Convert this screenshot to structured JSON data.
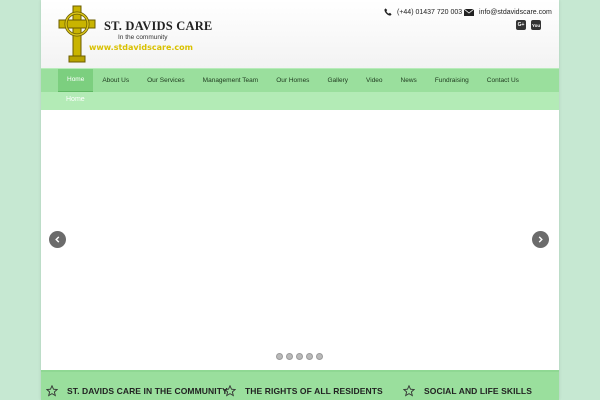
{
  "header": {
    "brand_name": "ST. DAVIDS CARE",
    "tagline": "In the community",
    "website": "www.stdavidscare.com",
    "phone": "(+44) 01437 720 003",
    "email": "info@stdavidscare.com",
    "social": [
      {
        "name": "google-plus",
        "label": "G+"
      },
      {
        "name": "youtube",
        "label": "You"
      }
    ]
  },
  "nav": {
    "items": [
      {
        "label": "Home",
        "active": true
      },
      {
        "label": "About Us"
      },
      {
        "label": "Our Services"
      },
      {
        "label": "Management Team"
      },
      {
        "label": "Our Homes"
      },
      {
        "label": "Gallery"
      },
      {
        "label": "Video"
      },
      {
        "label": "News"
      },
      {
        "label": "Fundraising"
      },
      {
        "label": "Contact Us"
      }
    ]
  },
  "breadcrumb": {
    "current": "Home"
  },
  "slider": {
    "slide_count": 5
  },
  "features": [
    {
      "title": "ST. DAVIDS CARE IN THE COMMUNITY"
    },
    {
      "title": "THE RIGHTS OF ALL RESIDENTS"
    },
    {
      "title": "SOCIAL AND LIFE SKILLS"
    }
  ],
  "colors": {
    "background": "#c6e8d2",
    "nav_green": "#9adf9d",
    "breadcrumb_green": "#b3ebb6",
    "logo_gold": "#d9c100"
  }
}
